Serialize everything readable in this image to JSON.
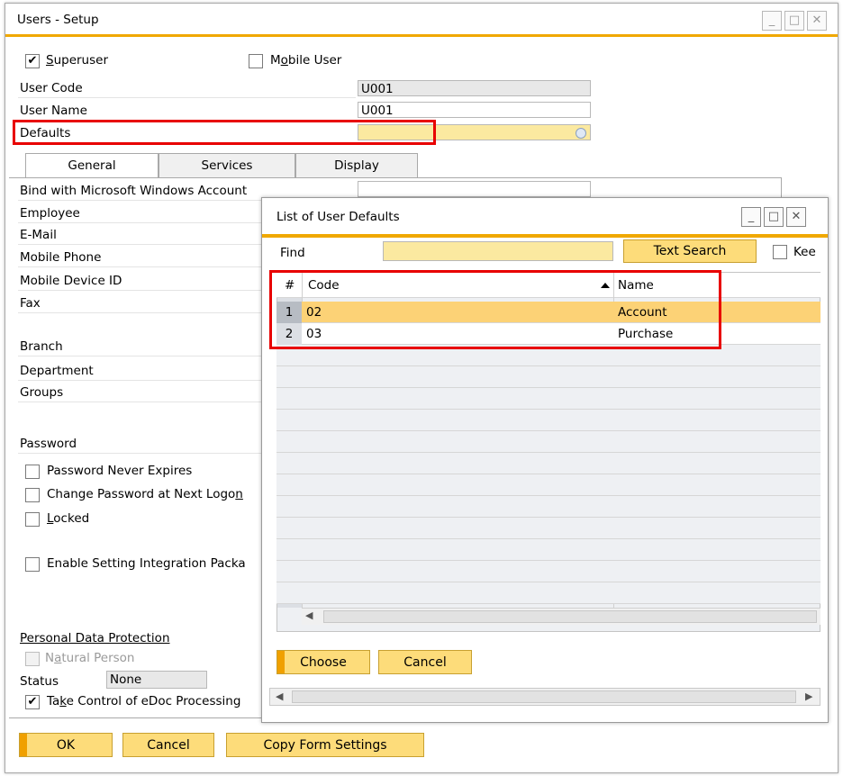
{
  "window": {
    "title": "Users - Setup"
  },
  "form": {
    "superuser_label": "Superuser",
    "superuser_checked": true,
    "mobile_user_label": "Mobile User",
    "mobile_user_checked": false,
    "user_code_label": "User Code",
    "user_code_value": "U001",
    "user_name_label": "User Name",
    "user_name_value": "U001",
    "defaults_label": "Defaults",
    "defaults_value": ""
  },
  "tabs": [
    {
      "label": "General",
      "active": true
    },
    {
      "label": "Services",
      "active": false
    },
    {
      "label": "Display",
      "active": false
    }
  ],
  "general": {
    "bind_windows_label": "Bind with Microsoft Windows Account",
    "employee_label": "Employee",
    "email_label": "E-Mail",
    "mobile_phone_label": "Mobile Phone",
    "mobile_device_label": "Mobile Device ID",
    "fax_label": "Fax",
    "branch_label": "Branch",
    "department_label": "Department",
    "groups_label": "Groups",
    "password_label": "Password",
    "pwd_never_expires_label": "Password Never Expires",
    "change_pwd_label": "Change Password at Next Logon",
    "locked_label": "Locked",
    "enable_integration_label": "Enable Setting Integration Packa",
    "personal_data_label": "Personal Data Protection",
    "natural_person_label": "Natural Person",
    "status_label": "Status",
    "status_value": "None",
    "take_control_label": "Take Control of eDoc Processing",
    "take_control_checked": true
  },
  "buttons": {
    "ok": "OK",
    "cancel": "Cancel",
    "copy_form_settings": "Copy Form Settings"
  },
  "dialog": {
    "title": "List of User Defaults",
    "find_label": "Find",
    "find_value": "",
    "text_search_label": "Text Search",
    "keep_label": "Kee",
    "columns": {
      "num": "#",
      "code": "Code",
      "name": "Name"
    },
    "rows": [
      {
        "num": "1",
        "code": "02",
        "name": "Account"
      },
      {
        "num": "2",
        "code": "03",
        "name": "Purchase"
      }
    ],
    "choose_label": "Choose",
    "cancel_label": "Cancel"
  },
  "colors": {
    "accent_orange": "#f0a800",
    "button_yellow": "#fddc7a",
    "selected_row": "#fcd276",
    "highlight_red": "#e80000"
  }
}
